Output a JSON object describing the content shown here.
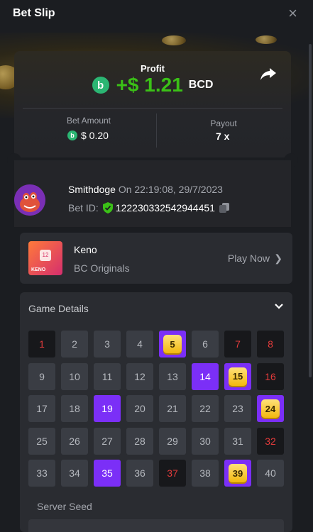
{
  "header": {
    "title": "Bet Slip",
    "close_icon": "×"
  },
  "result": {
    "profit_label": "Profit",
    "profit_value": "+$ 1.21",
    "currency": "BCD",
    "bet_amount_label": "Bet Amount",
    "bet_amount_value": "$ 0.20",
    "payout_label": "Payout",
    "payout_value": "7 x",
    "profit_color": "#3bc117"
  },
  "user": {
    "name": "Smithdoge",
    "time_text": "On 22:19:08, 29/7/2023",
    "bet_id_label": "Bet ID:",
    "bet_id": "122230332542944451"
  },
  "game": {
    "name": "Keno",
    "provider": "BC Originals",
    "play_label": "Play Now",
    "thumb_text": "KENO",
    "thumb_tile": "12"
  },
  "details": {
    "title": "Game Details",
    "server_seed_label": "Server Seed",
    "cells": [
      {
        "n": "1",
        "state": "miss"
      },
      {
        "n": "2",
        "state": "none"
      },
      {
        "n": "3",
        "state": "none"
      },
      {
        "n": "4",
        "state": "none"
      },
      {
        "n": "5",
        "state": "hit"
      },
      {
        "n": "6",
        "state": "none"
      },
      {
        "n": "7",
        "state": "miss"
      },
      {
        "n": "8",
        "state": "miss"
      },
      {
        "n": "9",
        "state": "none"
      },
      {
        "n": "10",
        "state": "none"
      },
      {
        "n": "11",
        "state": "none"
      },
      {
        "n": "12",
        "state": "none"
      },
      {
        "n": "13",
        "state": "none"
      },
      {
        "n": "14",
        "state": "pick"
      },
      {
        "n": "15",
        "state": "hit"
      },
      {
        "n": "16",
        "state": "miss"
      },
      {
        "n": "17",
        "state": "none"
      },
      {
        "n": "18",
        "state": "none"
      },
      {
        "n": "19",
        "state": "pick"
      },
      {
        "n": "20",
        "state": "none"
      },
      {
        "n": "21",
        "state": "none"
      },
      {
        "n": "22",
        "state": "none"
      },
      {
        "n": "23",
        "state": "none"
      },
      {
        "n": "24",
        "state": "hit"
      },
      {
        "n": "25",
        "state": "none"
      },
      {
        "n": "26",
        "state": "none"
      },
      {
        "n": "27",
        "state": "none"
      },
      {
        "n": "28",
        "state": "none"
      },
      {
        "n": "29",
        "state": "none"
      },
      {
        "n": "30",
        "state": "none"
      },
      {
        "n": "31",
        "state": "none"
      },
      {
        "n": "32",
        "state": "miss"
      },
      {
        "n": "33",
        "state": "none"
      },
      {
        "n": "34",
        "state": "none"
      },
      {
        "n": "35",
        "state": "pick"
      },
      {
        "n": "36",
        "state": "none"
      },
      {
        "n": "37",
        "state": "miss"
      },
      {
        "n": "38",
        "state": "none"
      },
      {
        "n": "39",
        "state": "hit"
      },
      {
        "n": "40",
        "state": "none"
      }
    ]
  },
  "colors": {
    "accent": "#7b2ff7",
    "miss": "#e23b3b",
    "gem": "#f2b80e",
    "currency_icon": "#2bb673"
  },
  "icons": [
    "close-icon",
    "share-icon",
    "bcd-coin-icon",
    "verified-shield-icon",
    "copy-icon",
    "chevron-right-icon",
    "chevron-down-icon"
  ]
}
